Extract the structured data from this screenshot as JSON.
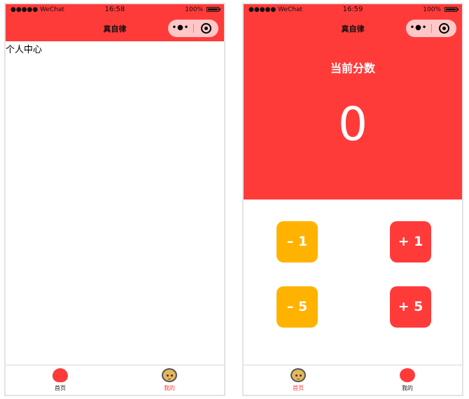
{
  "colors": {
    "accent": "#ff3b3a",
    "minus_button": "#ffb300",
    "capsule": "#ffc7c7"
  },
  "left_screen": {
    "status": {
      "carrier": "●●●●● WeChat",
      "time": "16:58",
      "battery": "100%"
    },
    "nav_title": "真自律",
    "content_text": "个人中心",
    "tabs": [
      {
        "label": "首页",
        "icon": "home-blob-icon",
        "active": false
      },
      {
        "label": "我的",
        "icon": "face-icon",
        "active": true
      }
    ]
  },
  "right_screen": {
    "status": {
      "carrier": "●●●●● WeChat",
      "time": "16:59",
      "battery": "100%"
    },
    "nav_title": "真自律",
    "score_label": "当前分数",
    "score_value": "0",
    "buttons": {
      "minus_1": "– 1",
      "plus_1": "+ 1",
      "minus_5": "– 5",
      "plus_5": "+ 5"
    },
    "tabs": [
      {
        "label": "首页",
        "icon": "face-icon",
        "active": true
      },
      {
        "label": "我的",
        "icon": "circle-icon",
        "active": false
      }
    ]
  }
}
